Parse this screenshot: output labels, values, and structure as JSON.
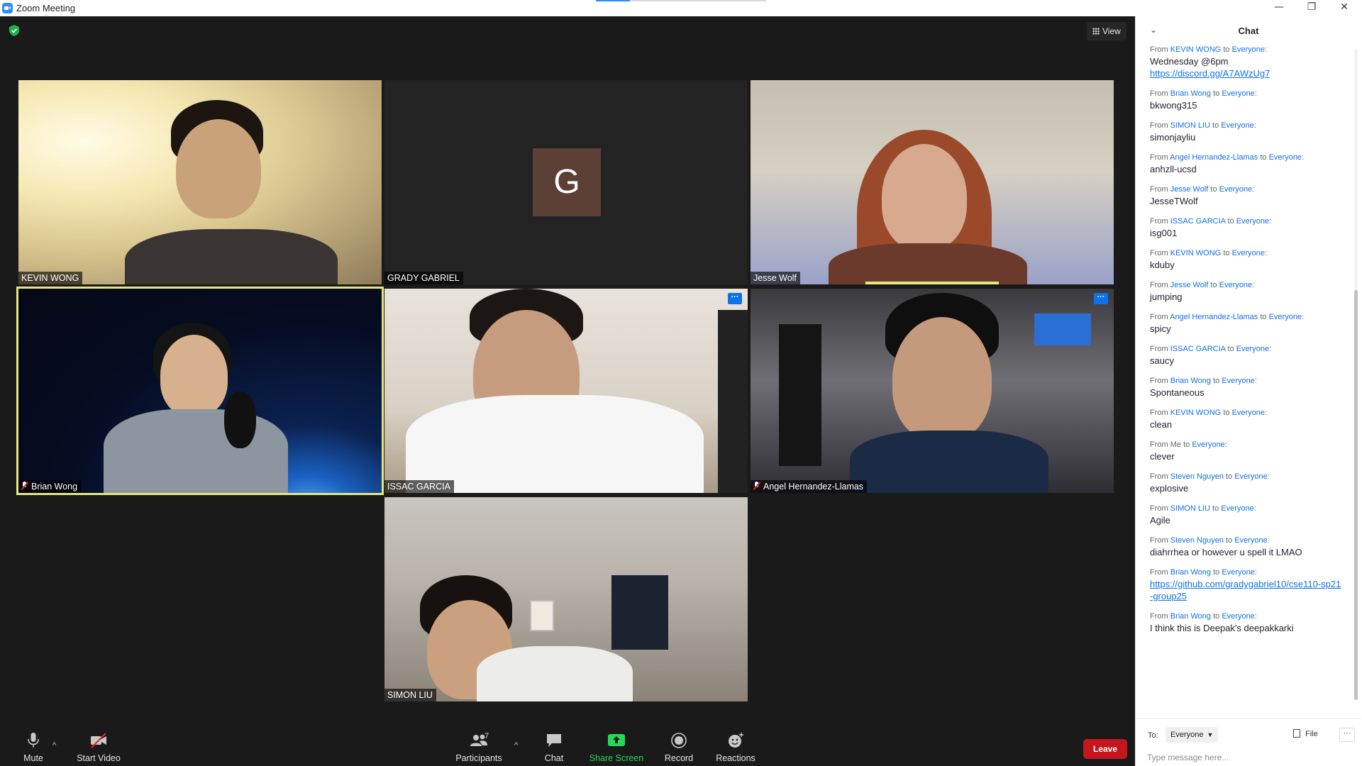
{
  "window": {
    "title": "Zoom Meeting",
    "title_progress": 0.2,
    "min_glyph": "—",
    "max_glyph": "❐",
    "close_glyph": "✕"
  },
  "view": {
    "label": "View"
  },
  "tiles": [
    {
      "name": "KEVIN WONG",
      "muted": false,
      "active": false,
      "more": false,
      "scene": "bright"
    },
    {
      "name": "GRADY GABRIEL",
      "initial": "G",
      "muted": false,
      "active": false,
      "more": false,
      "scene": "avatar"
    },
    {
      "name": "Jesse Wolf",
      "muted": false,
      "active": false,
      "more": false,
      "speaking": true,
      "scene": "chair"
    },
    {
      "name": "Brian Wong",
      "muted": true,
      "active": true,
      "more": false,
      "scene": "space"
    },
    {
      "name": "ISSAC GARCIA",
      "muted": false,
      "active": false,
      "more": true,
      "scene": "wall"
    },
    {
      "name": "Angel Hernandez-Llamas",
      "muted": true,
      "active": false,
      "more": true,
      "scene": "dark"
    },
    {
      "name": "SIMON LIU",
      "muted": false,
      "active": false,
      "more": false,
      "scene": "room"
    }
  ],
  "toolbar": {
    "mute": "Mute",
    "start_video": "Start Video",
    "participants": "Participants",
    "participants_count": "7",
    "chat": "Chat",
    "share_screen": "Share Screen",
    "record": "Record",
    "reactions": "Reactions",
    "leave": "Leave",
    "more_glyph": "···",
    "caret_glyph": "^"
  },
  "chat": {
    "title": "Chat",
    "collapse_glyph": "⌄",
    "from_word": "From",
    "to_word": "to",
    "messages": [
      {
        "from": "KEVIN WONG",
        "to": "Everyone",
        "lines": [
          "Wednesday @6pm"
        ],
        "link": "https://discord.gg/A7AWzUg7"
      },
      {
        "from": "Brian Wong",
        "to": "Everyone",
        "lines": [
          "bkwong315"
        ]
      },
      {
        "from": "SIMON LIU",
        "to": "Everyone",
        "lines": [
          "simonjayliu"
        ]
      },
      {
        "from": "Angel Hernandez-Llamas",
        "to": "Everyone",
        "lines": [
          "anhzll-ucsd"
        ]
      },
      {
        "from": "Jesse Wolf",
        "to": "Everyone",
        "lines": [
          "JesseTWolf"
        ]
      },
      {
        "from": "ISSAC GARCIA",
        "to": "Everyone",
        "lines": [
          "isg001"
        ]
      },
      {
        "from": "KEVIN WONG",
        "to": "Everyone",
        "lines": [
          "kduby"
        ]
      },
      {
        "from": "Jesse Wolf",
        "to": "Everyone",
        "lines": [
          "jumping"
        ]
      },
      {
        "from": "Angel Hernandez-Llamas",
        "to": "Everyone",
        "lines": [
          "spicy"
        ]
      },
      {
        "from": "ISSAC GARCIA",
        "to": "Everyone",
        "lines": [
          "saucy"
        ]
      },
      {
        "from": "Brian Wong",
        "to": "Everyone",
        "lines": [
          "Spontaneous"
        ]
      },
      {
        "from": "KEVIN WONG",
        "to": "Everyone",
        "lines": [
          "clean"
        ]
      },
      {
        "from": "Me",
        "to": "Everyone",
        "lines": [
          "clever"
        ],
        "self": true
      },
      {
        "from": "Steven Nguyen",
        "to": "Everyone",
        "lines": [
          "explosive"
        ]
      },
      {
        "from": "SIMON LIU",
        "to": "Everyone",
        "lines": [
          "Agile"
        ]
      },
      {
        "from": "Steven Nguyen",
        "to": "Everyone",
        "lines": [
          "diahrrhea or however u spell it LMAO"
        ]
      },
      {
        "from": "Brian Wong",
        "to": "Everyone",
        "lines": [],
        "link": "https://github.com/gradygabriel10/cse110-sp21-group25"
      },
      {
        "from": "Brian Wong",
        "to": "Everyone",
        "lines": [
          "I think this is Deepak's deepakkarki"
        ]
      }
    ],
    "to_label": "To:",
    "recipient": "Everyone",
    "file_label": "File",
    "more_glyph": "···",
    "placeholder": "Type message here..."
  }
}
